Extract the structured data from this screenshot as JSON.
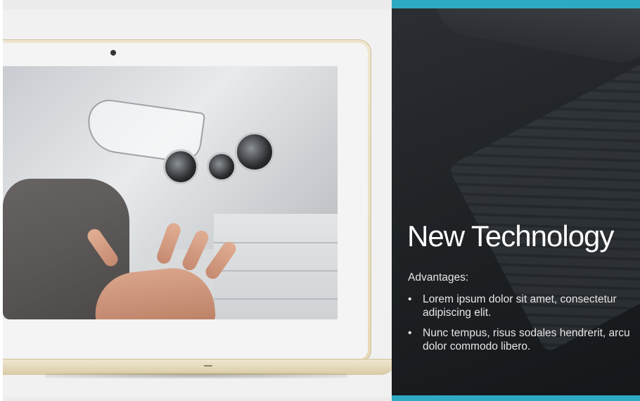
{
  "slide": {
    "title": "New Technology",
    "subtitle": "Advantages:",
    "bullets": [
      "Lorem ipsum dolor sit amet, consectetur adipiscing elit.",
      "Nunc tempus, risus sodales hendrerit, arcu dolor commodo libero."
    ],
    "bullet_glyph": "•"
  },
  "colors": {
    "accent": "#2ea9c4",
    "panel_dark": "#1d2124",
    "laptop_gold": "#e6dab8"
  }
}
